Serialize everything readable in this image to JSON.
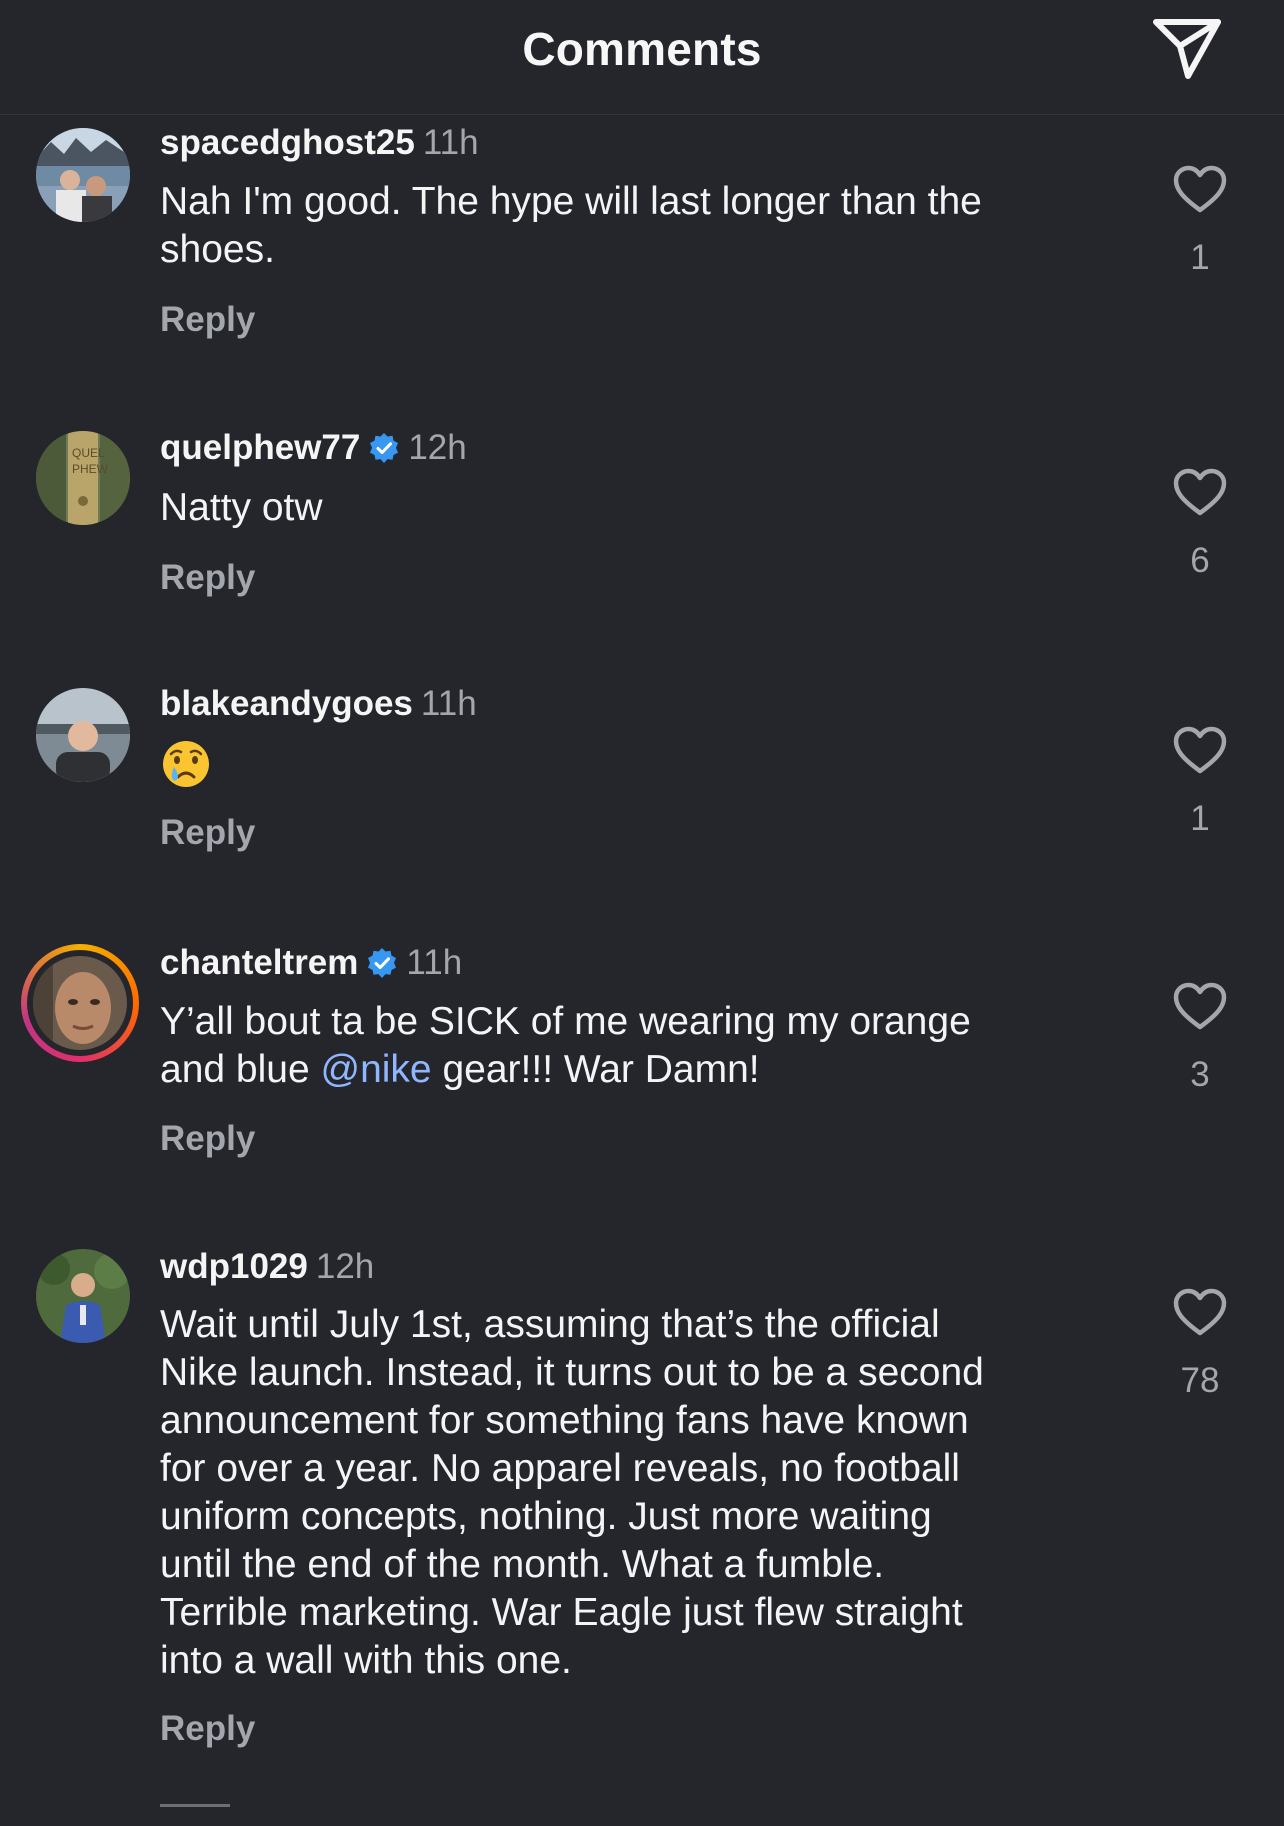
{
  "header": {
    "title": "Comments"
  },
  "comments": [
    {
      "username": "spacedghost25",
      "verified": false,
      "time": "11h",
      "text_line1": "Nah I'm good. The hype will last longer than the",
      "text_line2": "shoes.",
      "reply_label": "Reply",
      "likes": "1"
    },
    {
      "username": "quelphew77",
      "verified": true,
      "time": "12h",
      "text": "Natty otw",
      "reply_label": "Reply",
      "likes": "6"
    },
    {
      "username": "blakeandygoes",
      "verified": false,
      "time": "11h",
      "emoji": "crying-face",
      "reply_label": "Reply",
      "likes": "1"
    },
    {
      "username": "chanteltrem",
      "verified": true,
      "time": "11h",
      "text_line1": "Y’all bout ta be SICK of me wearing my orange",
      "text_line2_before": "and blue ",
      "mention": "@nike",
      "text_line2_after": " gear!!! War Damn!",
      "reply_label": "Reply",
      "likes": "3",
      "has_story_ring": true
    },
    {
      "username": "wdp1029",
      "verified": false,
      "time": "12h",
      "text_lines": [
        "Wait until July 1st, assuming that’s the official",
        "Nike launch. Instead, it turns out to be a second",
        "announcement for something fans have known",
        "for over a year. No apparel reveals, no football",
        "uniform concepts, nothing. Just more waiting",
        "until the end of the month. What a fumble.",
        "Terrible marketing. War Eagle just flew straight",
        "into a wall with this one."
      ],
      "reply_label": "Reply",
      "likes": "78"
    }
  ],
  "colors": {
    "background": "#25262b",
    "text": "#f3f4f6",
    "muted": "#a4a6ad",
    "mention": "#8fb7ff",
    "verified": "#3897f0"
  },
  "icons": {
    "share": "paper-plane-icon",
    "like": "heart-outline-icon",
    "verified": "verified-badge-icon"
  }
}
